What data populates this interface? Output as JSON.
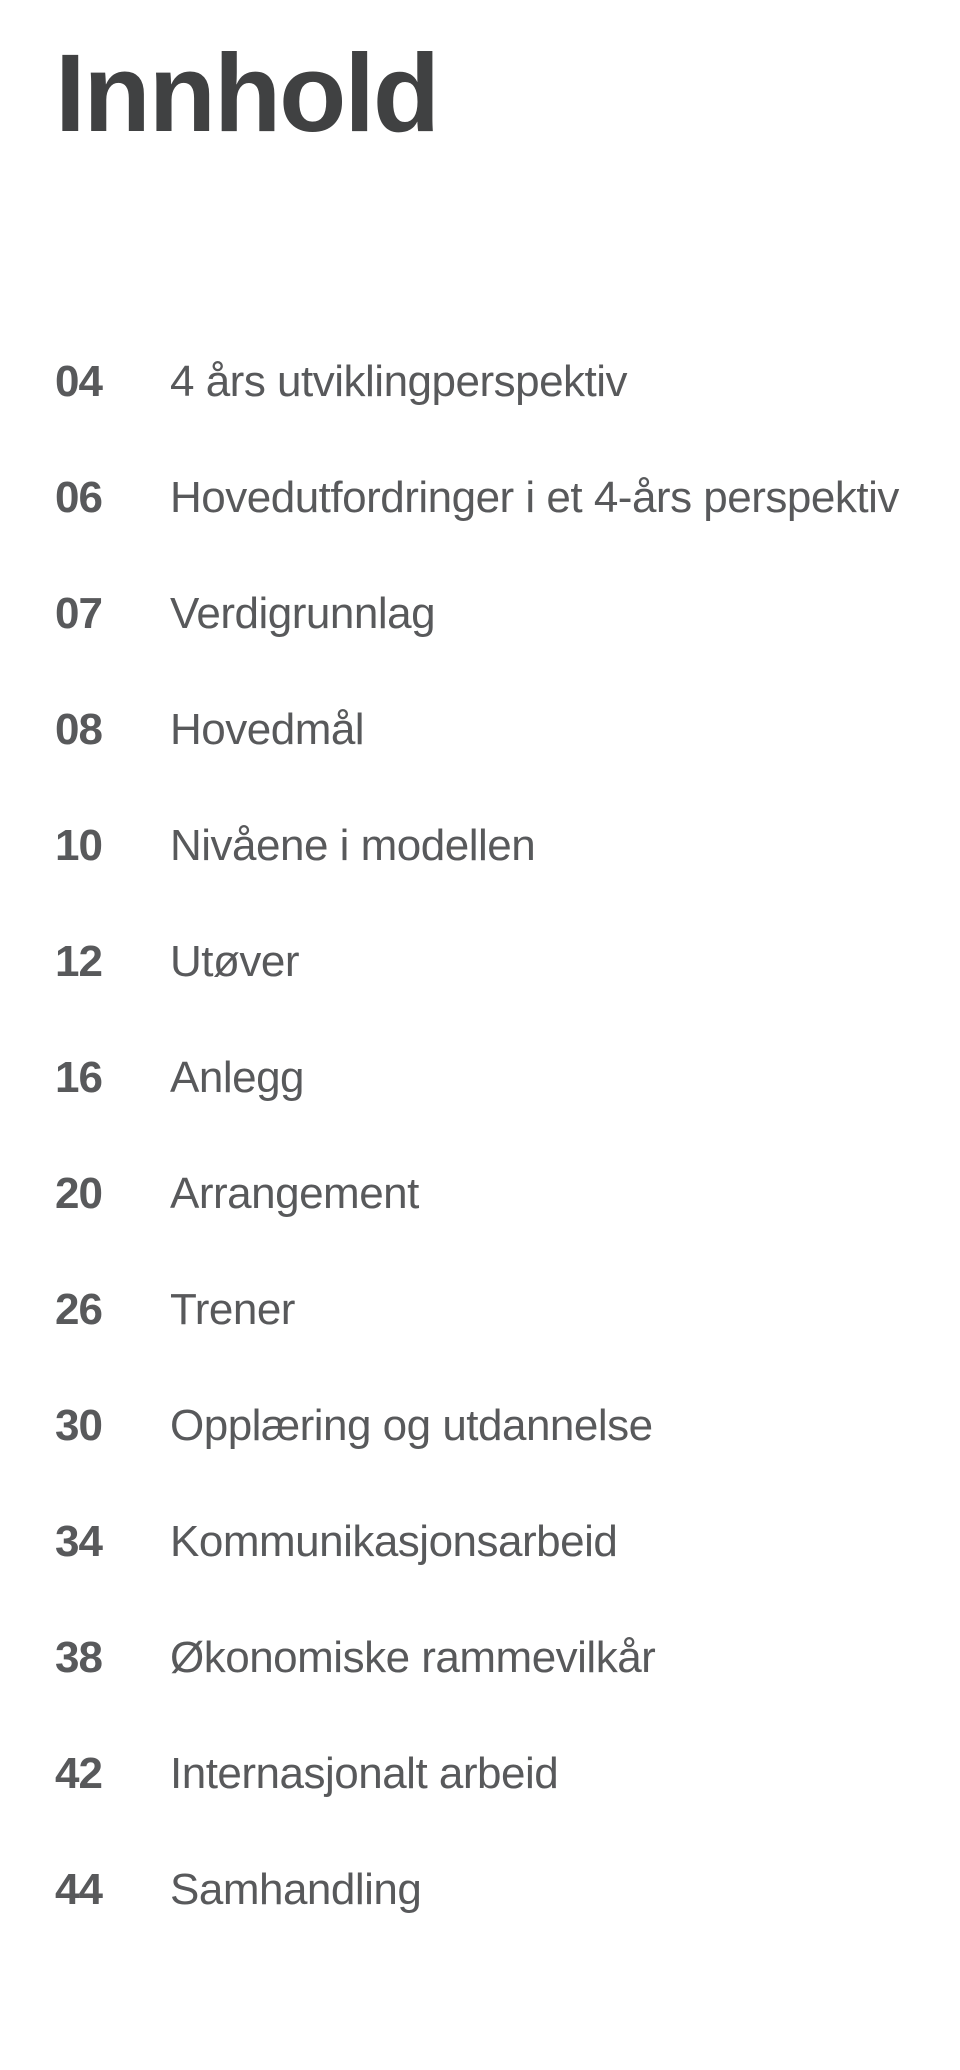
{
  "title": "Innhold",
  "toc": [
    {
      "page": "04",
      "label": "4 års utviklingperspektiv"
    },
    {
      "page": "06",
      "label": "Hovedutfordringer i et 4-års perspektiv"
    },
    {
      "page": "07",
      "label": "Verdigrunnlag"
    },
    {
      "page": "08",
      "label": "Hovedmål"
    },
    {
      "page": "10",
      "label": "Nivåene i modellen"
    },
    {
      "page": "12",
      "label": "Utøver"
    },
    {
      "page": "16",
      "label": "Anlegg"
    },
    {
      "page": "20",
      "label": "Arrangement"
    },
    {
      "page": "26",
      "label": "Trener"
    },
    {
      "page": "30",
      "label": "Opplæring og utdannelse"
    },
    {
      "page": "34",
      "label": "Kommunikasjonsarbeid"
    },
    {
      "page": "38",
      "label": "Økonomiske rammevilkår"
    },
    {
      "page": "42",
      "label": "Internasjonalt arbeid"
    },
    {
      "page": "44",
      "label": "Samhandling"
    }
  ]
}
